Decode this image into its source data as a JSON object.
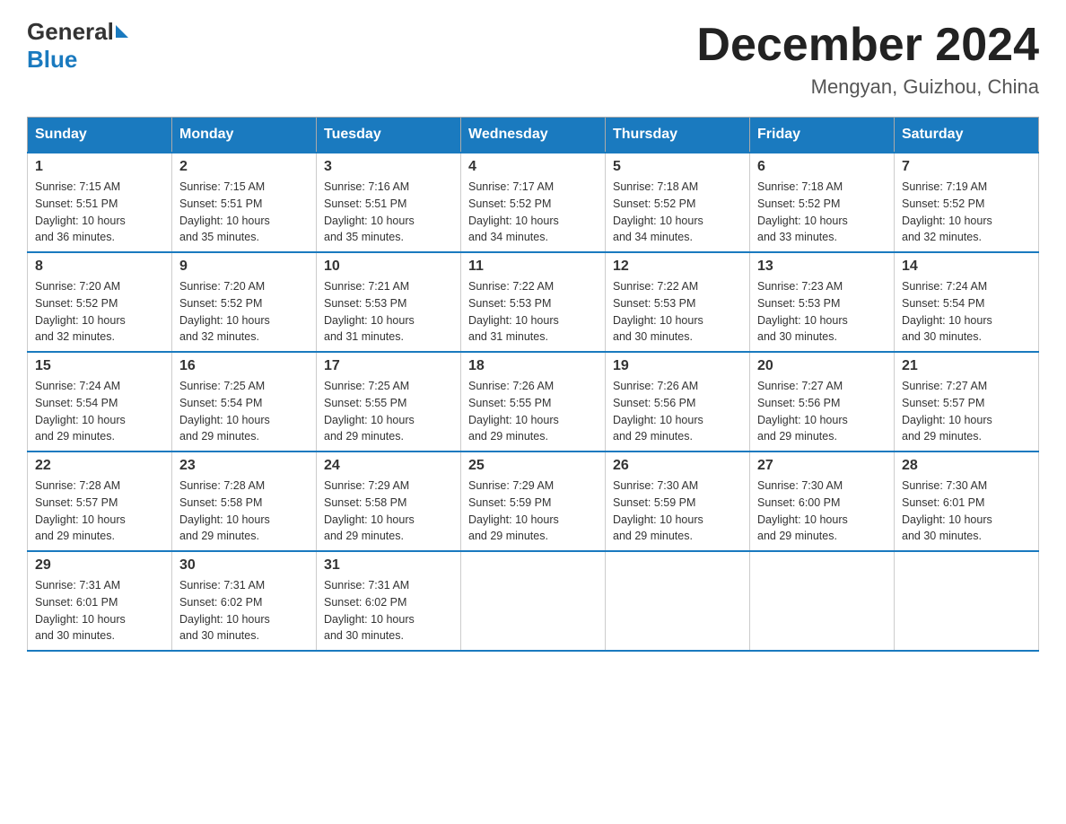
{
  "logo": {
    "general": "General",
    "blue": "Blue"
  },
  "title": "December 2024",
  "location": "Mengyan, Guizhou, China",
  "days_of_week": [
    "Sunday",
    "Monday",
    "Tuesday",
    "Wednesday",
    "Thursday",
    "Friday",
    "Saturday"
  ],
  "weeks": [
    [
      {
        "day": "1",
        "sunrise": "7:15 AM",
        "sunset": "5:51 PM",
        "daylight": "10 hours and 36 minutes."
      },
      {
        "day": "2",
        "sunrise": "7:15 AM",
        "sunset": "5:51 PM",
        "daylight": "10 hours and 35 minutes."
      },
      {
        "day": "3",
        "sunrise": "7:16 AM",
        "sunset": "5:51 PM",
        "daylight": "10 hours and 35 minutes."
      },
      {
        "day": "4",
        "sunrise": "7:17 AM",
        "sunset": "5:52 PM",
        "daylight": "10 hours and 34 minutes."
      },
      {
        "day": "5",
        "sunrise": "7:18 AM",
        "sunset": "5:52 PM",
        "daylight": "10 hours and 34 minutes."
      },
      {
        "day": "6",
        "sunrise": "7:18 AM",
        "sunset": "5:52 PM",
        "daylight": "10 hours and 33 minutes."
      },
      {
        "day": "7",
        "sunrise": "7:19 AM",
        "sunset": "5:52 PM",
        "daylight": "10 hours and 32 minutes."
      }
    ],
    [
      {
        "day": "8",
        "sunrise": "7:20 AM",
        "sunset": "5:52 PM",
        "daylight": "10 hours and 32 minutes."
      },
      {
        "day": "9",
        "sunrise": "7:20 AM",
        "sunset": "5:52 PM",
        "daylight": "10 hours and 32 minutes."
      },
      {
        "day": "10",
        "sunrise": "7:21 AM",
        "sunset": "5:53 PM",
        "daylight": "10 hours and 31 minutes."
      },
      {
        "day": "11",
        "sunrise": "7:22 AM",
        "sunset": "5:53 PM",
        "daylight": "10 hours and 31 minutes."
      },
      {
        "day": "12",
        "sunrise": "7:22 AM",
        "sunset": "5:53 PM",
        "daylight": "10 hours and 30 minutes."
      },
      {
        "day": "13",
        "sunrise": "7:23 AM",
        "sunset": "5:53 PM",
        "daylight": "10 hours and 30 minutes."
      },
      {
        "day": "14",
        "sunrise": "7:24 AM",
        "sunset": "5:54 PM",
        "daylight": "10 hours and 30 minutes."
      }
    ],
    [
      {
        "day": "15",
        "sunrise": "7:24 AM",
        "sunset": "5:54 PM",
        "daylight": "10 hours and 29 minutes."
      },
      {
        "day": "16",
        "sunrise": "7:25 AM",
        "sunset": "5:54 PM",
        "daylight": "10 hours and 29 minutes."
      },
      {
        "day": "17",
        "sunrise": "7:25 AM",
        "sunset": "5:55 PM",
        "daylight": "10 hours and 29 minutes."
      },
      {
        "day": "18",
        "sunrise": "7:26 AM",
        "sunset": "5:55 PM",
        "daylight": "10 hours and 29 minutes."
      },
      {
        "day": "19",
        "sunrise": "7:26 AM",
        "sunset": "5:56 PM",
        "daylight": "10 hours and 29 minutes."
      },
      {
        "day": "20",
        "sunrise": "7:27 AM",
        "sunset": "5:56 PM",
        "daylight": "10 hours and 29 minutes."
      },
      {
        "day": "21",
        "sunrise": "7:27 AM",
        "sunset": "5:57 PM",
        "daylight": "10 hours and 29 minutes."
      }
    ],
    [
      {
        "day": "22",
        "sunrise": "7:28 AM",
        "sunset": "5:57 PM",
        "daylight": "10 hours and 29 minutes."
      },
      {
        "day": "23",
        "sunrise": "7:28 AM",
        "sunset": "5:58 PM",
        "daylight": "10 hours and 29 minutes."
      },
      {
        "day": "24",
        "sunrise": "7:29 AM",
        "sunset": "5:58 PM",
        "daylight": "10 hours and 29 minutes."
      },
      {
        "day": "25",
        "sunrise": "7:29 AM",
        "sunset": "5:59 PM",
        "daylight": "10 hours and 29 minutes."
      },
      {
        "day": "26",
        "sunrise": "7:30 AM",
        "sunset": "5:59 PM",
        "daylight": "10 hours and 29 minutes."
      },
      {
        "day": "27",
        "sunrise": "7:30 AM",
        "sunset": "6:00 PM",
        "daylight": "10 hours and 29 minutes."
      },
      {
        "day": "28",
        "sunrise": "7:30 AM",
        "sunset": "6:01 PM",
        "daylight": "10 hours and 30 minutes."
      }
    ],
    [
      {
        "day": "29",
        "sunrise": "7:31 AM",
        "sunset": "6:01 PM",
        "daylight": "10 hours and 30 minutes."
      },
      {
        "day": "30",
        "sunrise": "7:31 AM",
        "sunset": "6:02 PM",
        "daylight": "10 hours and 30 minutes."
      },
      {
        "day": "31",
        "sunrise": "7:31 AM",
        "sunset": "6:02 PM",
        "daylight": "10 hours and 30 minutes."
      },
      null,
      null,
      null,
      null
    ]
  ],
  "labels": {
    "sunrise": "Sunrise:",
    "sunset": "Sunset:",
    "daylight": "Daylight:"
  }
}
